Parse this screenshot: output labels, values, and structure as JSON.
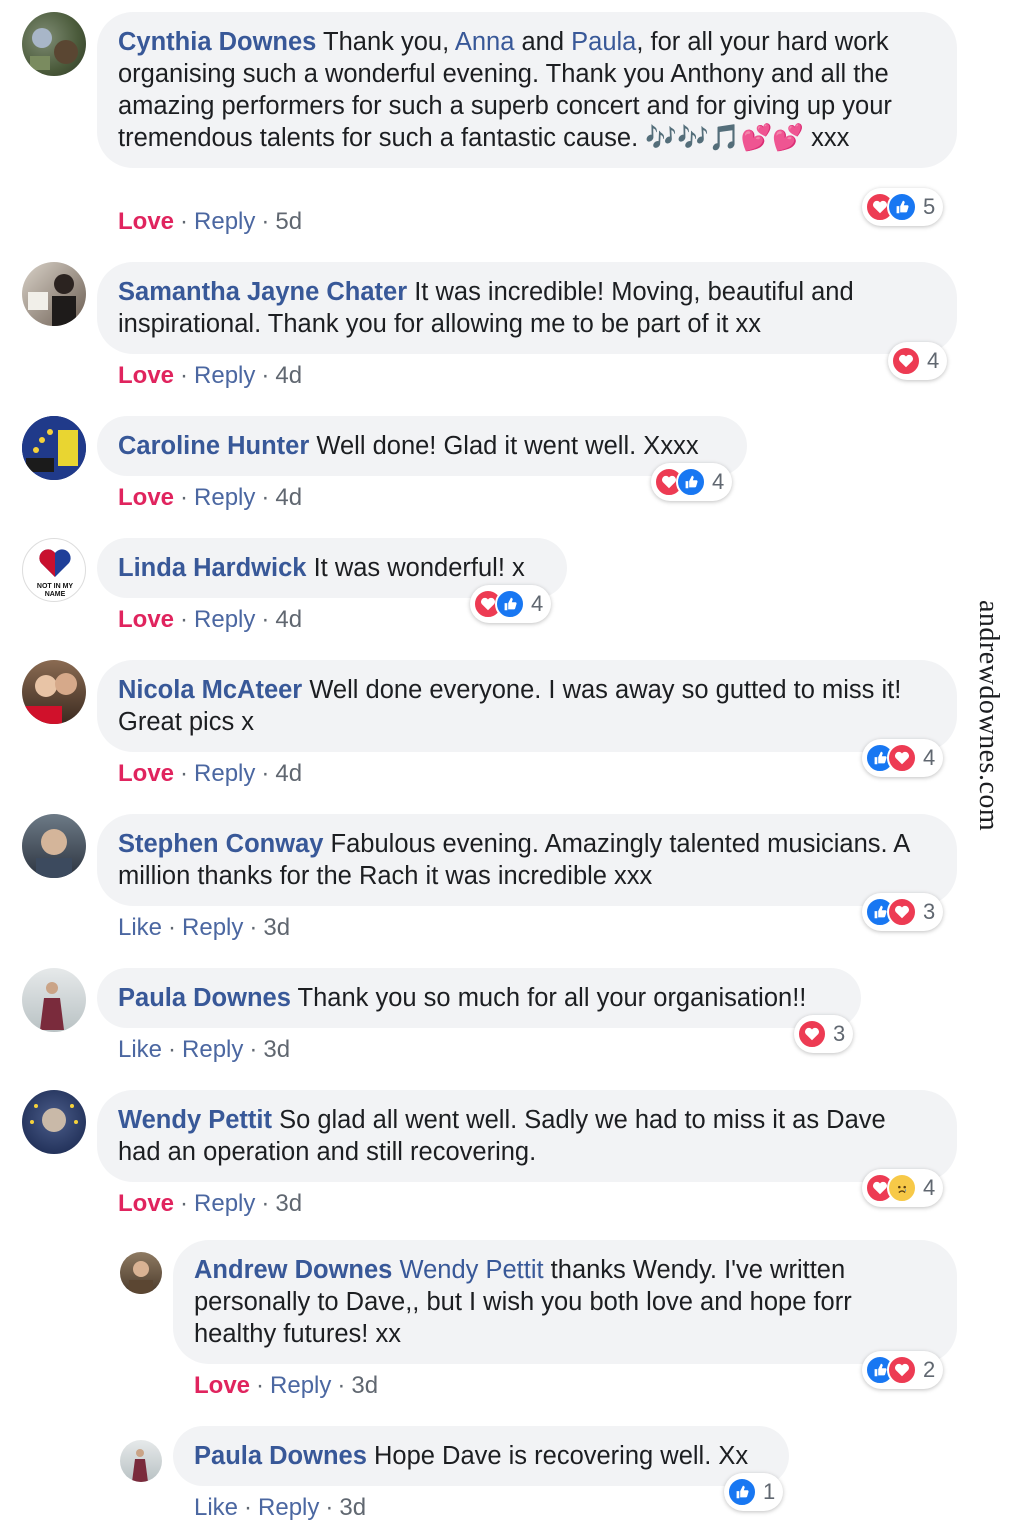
{
  "watermark": "andrewdownes.com",
  "labels": {
    "love": "Love",
    "like": "Like",
    "reply": "Reply",
    "dot": "·"
  },
  "comments": [
    {
      "author": "Cynthia Downes",
      "text_parts": [
        "Thank you, ",
        "Anna",
        " and ",
        "Paula",
        ", for all your hard work organising such a wonderful evening. Thank you Anthony and all the amazing performers for such a superb concert and for giving up your tremendous talents for such a fantastic cause. 🎶🎶🎵💕💕 xxx"
      ],
      "action": "Love",
      "time": "5d",
      "reactions": [
        "love",
        "like"
      ],
      "count": "5"
    },
    {
      "author": "Samantha Jayne Chater",
      "text": "It was incredible! Moving, beautiful and inspirational. Thank you for allowing me to be part of it xx",
      "action": "Love",
      "time": "4d",
      "reactions": [
        "love"
      ],
      "count": "4"
    },
    {
      "author": "Caroline Hunter",
      "text": "Well done! Glad it went well. Xxxx",
      "action": "Love",
      "time": "4d",
      "reactions": [
        "love",
        "like"
      ],
      "count": "4"
    },
    {
      "author": "Linda Hardwick",
      "text": "It was wonderful! x",
      "action": "Love",
      "time": "4d",
      "reactions": [
        "love",
        "like"
      ],
      "count": "4",
      "avatar_text": "NOT IN MY NAME"
    },
    {
      "author": "Nicola McAteer",
      "text": "Well done everyone. I was away so gutted to miss it! Great pics x",
      "action": "Love",
      "time": "4d",
      "reactions": [
        "like",
        "love"
      ],
      "count": "4"
    },
    {
      "author": "Stephen Conway",
      "text": "Fabulous evening. Amazingly talented musicians. A million thanks for the Rach it was incredible xxx",
      "action": "Like",
      "time": "3d",
      "reactions": [
        "like",
        "love"
      ],
      "count": "3"
    },
    {
      "author": "Paula Downes",
      "text": "Thank you so much for all your organisation!!",
      "action": "Like",
      "time": "3d",
      "reactions": [
        "love"
      ],
      "count": "3"
    },
    {
      "author": "Wendy Pettit",
      "text": "So glad all went well. Sadly we had to miss it as Dave had an operation and still recovering.",
      "action": "Love",
      "time": "3d",
      "reactions": [
        "love",
        "sad"
      ],
      "count": "4"
    },
    {
      "author": "Andrew Downes",
      "mention": "Wendy Pettit",
      "text": "thanks Wendy. I've written personally to Dave,, but I wish you both love and hope forr healthy futures! xx",
      "action": "Love",
      "time": "3d",
      "reactions": [
        "like",
        "love"
      ],
      "count": "2"
    },
    {
      "author": "Paula Downes",
      "text": "Hope Dave is recovering well. Xx",
      "action": "Like",
      "time": "3d",
      "reactions": [
        "like"
      ],
      "count": "1"
    }
  ],
  "colors": {
    "author": "#385898",
    "love": "#e0245e",
    "like_link": "#4b67a1",
    "bubble_bg": "#f2f3f5",
    "love_icon": "#ed3b53",
    "like_icon": "#1877f2"
  }
}
